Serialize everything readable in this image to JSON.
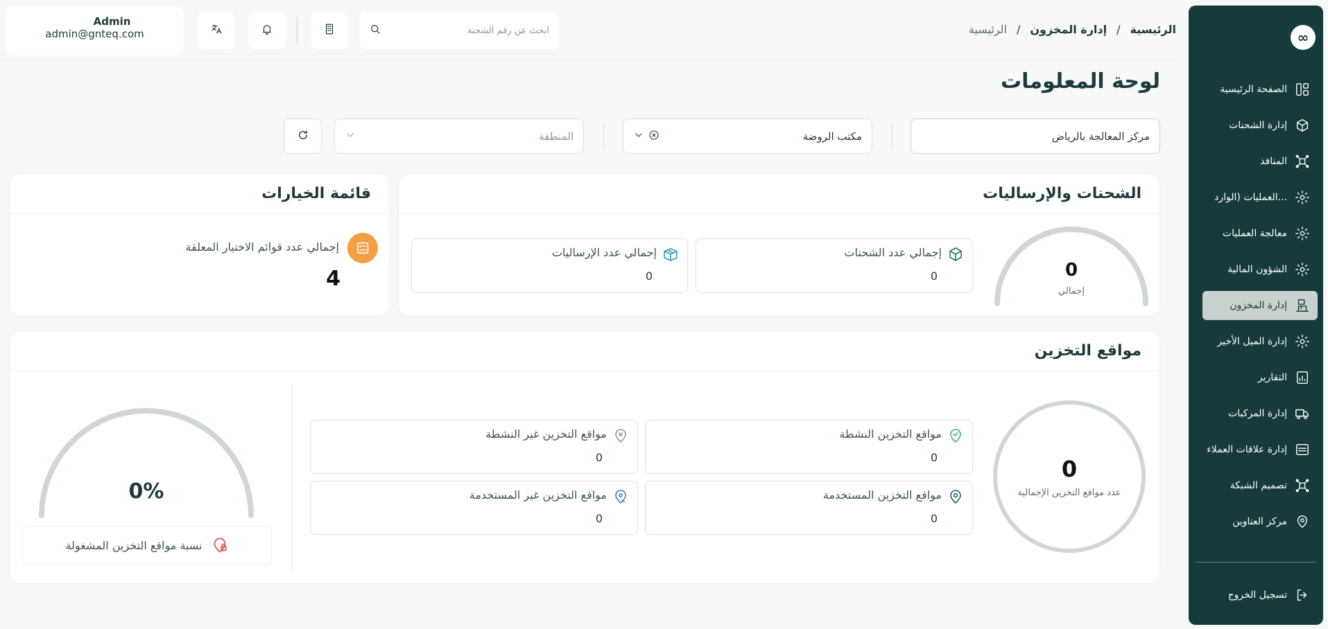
{
  "sidebar": {
    "logo": "∞",
    "items": [
      {
        "label": "الصفحة الرئيسية",
        "icon": "dashboard-icon",
        "active": false
      },
      {
        "label": "إدارة الشحنات",
        "icon": "shipment-icon",
        "active": false
      },
      {
        "label": "المنافذ",
        "icon": "network-icon",
        "active": false
      },
      {
        "label": "العمليات (الوارد...",
        "icon": "cog-icon",
        "active": false
      },
      {
        "label": "معالجة العمليات",
        "icon": "cog-icon",
        "active": false
      },
      {
        "label": "الشؤون المالية",
        "icon": "cog-icon",
        "active": false
      },
      {
        "label": "إدارة المخزون",
        "icon": "warehouse-icon",
        "active": true
      },
      {
        "label": "إدارة الميل الأخير",
        "icon": "cog-icon",
        "active": false
      },
      {
        "label": "التقارير",
        "icon": "report-icon",
        "active": false
      },
      {
        "label": "إدارة المركبات",
        "icon": "truck-icon",
        "active": false
      },
      {
        "label": "إدارة علاقات العملاء",
        "icon": "crm-icon",
        "active": false
      },
      {
        "label": "تصميم الشبكة",
        "icon": "network-icon",
        "active": false
      },
      {
        "label": "مركز العناوين",
        "icon": "location-icon",
        "active": false
      }
    ],
    "logout": "تسجيل الخروج"
  },
  "header": {
    "breadcrumb": [
      "الرئيسية",
      "إدارة المخزون",
      "الرئيسية"
    ],
    "search_placeholder": "ابحث عن رقم الشحنة",
    "user": {
      "name": "Admin",
      "email": "admin@gnteq.com"
    }
  },
  "page": {
    "title": "لوحة المعلومات",
    "filters": {
      "center": "مركز المعالجة بالرياض",
      "office": "مكتب الروضة",
      "region_placeholder": "المنطقة"
    }
  },
  "shipments": {
    "title": "الشحنات والإرسالیات",
    "gauge": {
      "value": "0",
      "label": "إجمالي",
      "fraction": 0
    },
    "total_shipments": {
      "label": "إجمالي عدد الشحنات",
      "value": "0"
    },
    "total_sendings": {
      "label": "إجمالي عدد الإرساليات",
      "value": "0"
    }
  },
  "picklists": {
    "title": "قائمة الخيارات",
    "pending": {
      "label": "إجمالي عدد قوائم الاختيار المعلقة",
      "value": "4"
    }
  },
  "storage": {
    "title": "مواقع التخزين",
    "total": {
      "value": "0",
      "label": "عدد مواقع التخزين الإجمالية"
    },
    "active": {
      "label": "مواقع التخزين النشطة",
      "value": "0"
    },
    "inactive": {
      "label": "مواقع التخزين غير النشطة",
      "value": "0"
    },
    "used": {
      "label": "مواقع التخزين المستخدمة",
      "value": "0"
    },
    "unused": {
      "label": "مواقع التخزين غير المستخدمة",
      "value": "0"
    },
    "occupancy": {
      "value": "0%",
      "label": "نسبة مواقع التخزين المشغولة",
      "fraction": 0
    }
  },
  "colors": {
    "sidebar": "#173a3c",
    "accent_orange": "#f29f45",
    "alert_red": "#e84b4b",
    "teal": "#1f7a70",
    "green": "#3cb371"
  }
}
